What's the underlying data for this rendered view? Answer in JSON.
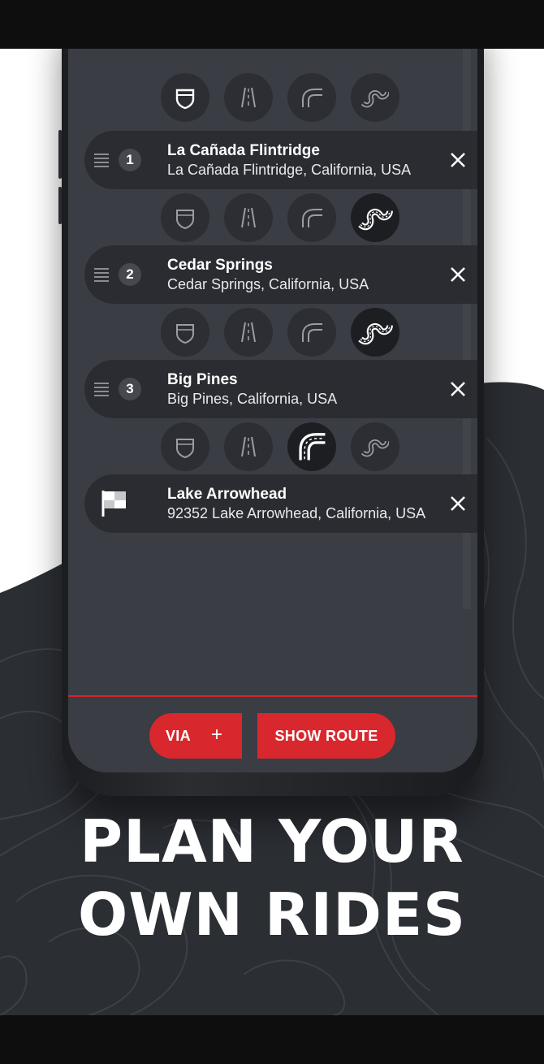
{
  "waypoints": [
    {
      "number": "1",
      "title": "La Cañada Flintridge",
      "subtitle": "La Cañada Flintridge, California, USA"
    },
    {
      "number": "2",
      "title": "Cedar Springs",
      "subtitle": "Cedar Springs, California, USA"
    },
    {
      "number": "3",
      "title": "Big Pines",
      "subtitle": "Big Pines, California, USA"
    }
  ],
  "destination": {
    "title": "Lake Arrowhead",
    "subtitle": "92352 Lake Arrowhead, California, USA"
  },
  "buttons": {
    "via_label": "VIA",
    "via_plus": "+",
    "show_route_label": "SHOW ROUTE"
  },
  "headline": {
    "line1": "PLAN YOUR",
    "line2": "OWN RIDES"
  },
  "road_types": {
    "icons": [
      "highway-icon",
      "straight-road-icon",
      "curvy-road-icon",
      "twisty-road-icon"
    ],
    "selected_per_leg": [
      "twisty-road-icon",
      "twisty-road-icon",
      "curvy-road-icon"
    ]
  },
  "colors": {
    "accent": "#d8282e",
    "screen_bg": "#3a3d44",
    "row_bg": "#2a2c31",
    "dark_bg": "#2b2e33"
  }
}
